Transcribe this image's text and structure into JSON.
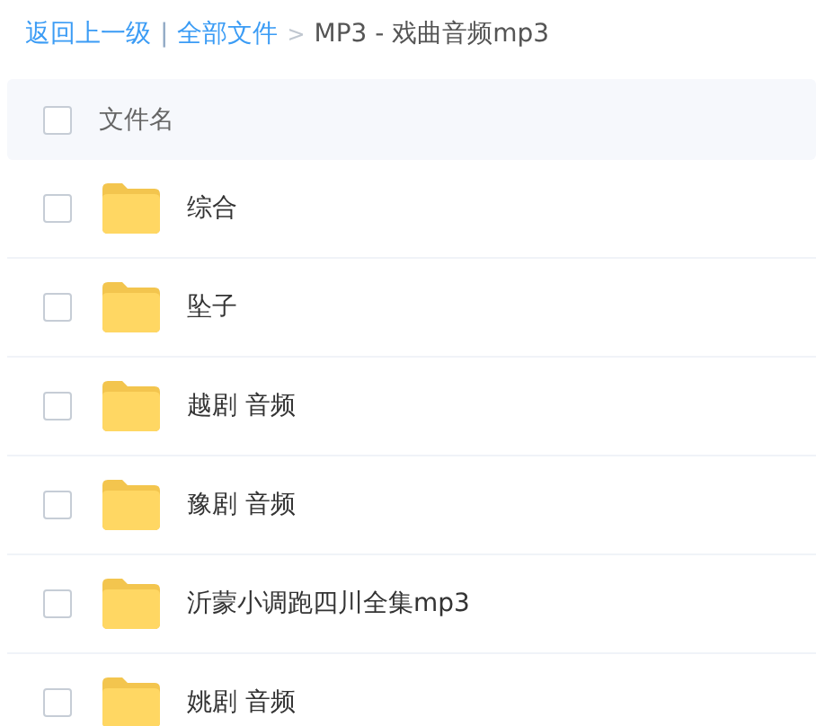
{
  "breadcrumb": {
    "back": "返回上一级",
    "separator": "|",
    "root": "全部文件",
    "arrow": ">",
    "current": "MP3 - 戏曲音频mp3"
  },
  "table": {
    "header": {
      "label": "文件名",
      "checked": false
    },
    "rows": [
      {
        "name": "综合",
        "checked": false
      },
      {
        "name": "坠子",
        "checked": false
      },
      {
        "name": "越剧 音频",
        "checked": false
      },
      {
        "name": "豫剧 音频",
        "checked": false
      },
      {
        "name": "沂蒙小调跑四川全集mp3",
        "checked": false
      },
      {
        "name": "姚剧 音频",
        "checked": false
      }
    ]
  }
}
